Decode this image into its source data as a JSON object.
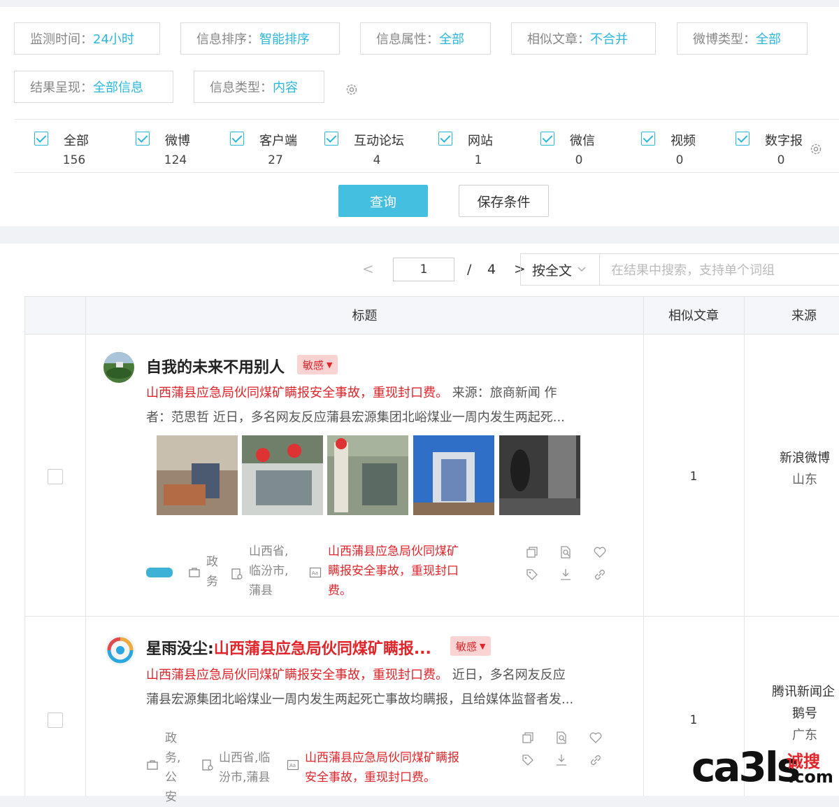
{
  "filters": {
    "row1": [
      {
        "label": "监测时间：",
        "value": "24小时"
      },
      {
        "label": "信息排序：",
        "value": "智能排序"
      },
      {
        "label": "信息属性：",
        "value": "全部"
      },
      {
        "label": "相似文章：",
        "value": "不合并"
      },
      {
        "label": "微博类型：",
        "value": "全部"
      }
    ],
    "row2": [
      {
        "label": "结果呈现：",
        "value": "全部信息"
      },
      {
        "label": "信息类型：",
        "value": "内容"
      }
    ]
  },
  "sources": [
    {
      "name": "全部",
      "count": "156"
    },
    {
      "name": "微博",
      "count": "124"
    },
    {
      "name": "客户端",
      "count": "27"
    },
    {
      "name": "互动论坛",
      "count": "4"
    },
    {
      "name": "网站",
      "count": "1"
    },
    {
      "name": "微信",
      "count": "0"
    },
    {
      "name": "视频",
      "count": "0"
    },
    {
      "name": "数字报",
      "count": "0"
    }
  ],
  "actions": {
    "query": "查询",
    "save": "保存条件"
  },
  "pager": {
    "prev": "<",
    "next": ">",
    "current": "1",
    "sep": "/",
    "total": "4"
  },
  "search": {
    "scope": "按全文",
    "placeholder": "在结果中搜索，支持单个词组"
  },
  "table": {
    "col_title": "标题",
    "col_similar": "相似文章",
    "col_source": "来源"
  },
  "rows": [
    {
      "author": "自我的未来不用别人",
      "badge": "敏感",
      "summary_red": "山西蒲县应急局伙同煤矿瞒报安全事故，重现封口费。",
      "summary_line1_rest": " 来源：旅商新闻 作",
      "summary_line2": "者：范思哲 近日，多名网友反应蒲县宏源集团北峪煤业一周内发生两起死...",
      "category": [
        "政",
        "务"
      ],
      "location": [
        "山西省,",
        "临汾市,",
        "蒲县"
      ],
      "keyword": [
        "山西蒲县应急局伙同煤矿",
        "瞒报安全事故，重现封口",
        "费。"
      ],
      "similar": "1",
      "source_name": "新浪微博",
      "source_region": "山东",
      "thumb_colors": [
        "#9a8570",
        "#6f7f6a",
        "#8e9a86",
        "#2f6fc7",
        "#3b3b3b"
      ]
    },
    {
      "author": "星雨没尘:",
      "title_red": "山西蒲县应急局伙同煤矿瞒报...",
      "badge": "敏感",
      "summary_red": "山西蒲县应急局伙同煤矿瞒报安全事故，重现封口费。",
      "summary_line1_rest": " 近日，多名网友反应",
      "summary_line2": "蒲县宏源集团北峪煤业一周内发生两起死亡事故均瞒报，且给媒体监督者发...",
      "category": [
        "政",
        "务,",
        "公",
        "安"
      ],
      "location": [
        "山西省,临",
        "汾市,蒲县"
      ],
      "keyword": [
        "山西蒲县应急局伙同煤矿瞒报",
        "安全事故，重现封口费。"
      ],
      "similar": "1",
      "source_name": "腾讯新闻企",
      "source_name2": "鹅号",
      "source_region": "广东"
    }
  ],
  "watermark": {
    "main": "ca3ls",
    "cn": "诚搜",
    "com": ".com"
  },
  "colors": {
    "accent": "#2db7de",
    "button": "#45bfe0",
    "danger": "#e0262b",
    "badge_bg": "#fbd3d3"
  }
}
